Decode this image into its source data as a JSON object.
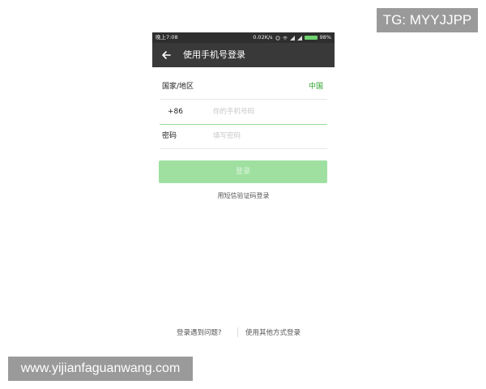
{
  "statusbar": {
    "time": "晚上7:08",
    "network_speed": "0.02K/s",
    "battery": "98%"
  },
  "header": {
    "title": "使用手机号登录",
    "back_icon": "back-arrow-icon"
  },
  "form": {
    "country_label": "国家/地区",
    "country_value": "中国",
    "country_code": "+86",
    "phone_placeholder": "你的手机号码",
    "phone_value": "",
    "password_label": "密码",
    "password_placeholder": "填写密码",
    "password_value": ""
  },
  "actions": {
    "login_label": "登录",
    "sms_login_label": "用短信验证码登录",
    "help_label": "登录遇到问题?",
    "other_login_label": "使用其他方式登录"
  },
  "overlays": {
    "tg_label": "TG: MYYJJPP",
    "site_label": "www.yijianfaguanwang.com"
  },
  "colors": {
    "accent": "#2aa32a",
    "login_button": "#9fe0a1",
    "titlebar": "#393939"
  }
}
